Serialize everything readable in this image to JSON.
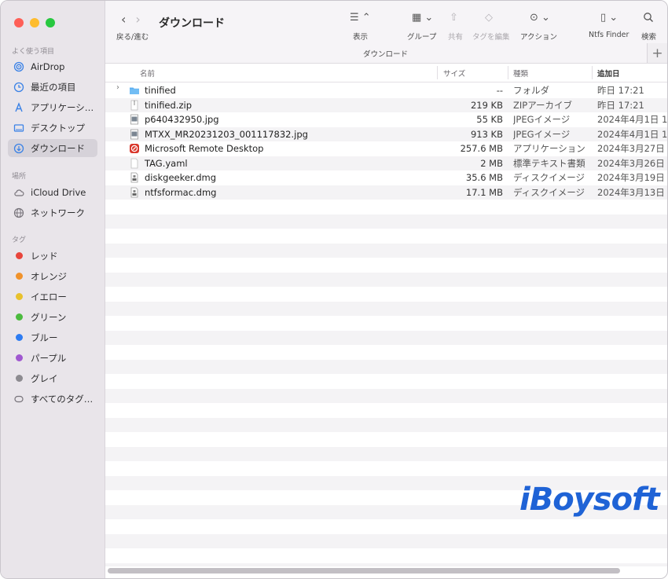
{
  "window": {
    "title": "ダウンロード"
  },
  "toolbar": {
    "back_forward_label": "戻る/進む",
    "view_label": "表示",
    "group_label": "グループ",
    "share_label": "共有",
    "tags_label": "タグを編集",
    "action_label": "アクション",
    "ntfs_label": "Ntfs Finder",
    "search_label": "検索",
    "path_title": "ダウンロード",
    "plus_label": "+"
  },
  "sidebar": {
    "favorites_header": "よく使う項目",
    "favorites": [
      {
        "label": "AirDrop",
        "icon": "airdrop-icon"
      },
      {
        "label": "最近の項目",
        "icon": "clock-icon"
      },
      {
        "label": "アプリケーシ…",
        "icon": "applications-icon"
      },
      {
        "label": "デスクトップ",
        "icon": "desktop-icon"
      },
      {
        "label": "ダウンロード",
        "icon": "download-icon"
      }
    ],
    "locations_header": "場所",
    "locations": [
      {
        "label": "iCloud Drive",
        "icon": "cloud-icon"
      },
      {
        "label": "ネットワーク",
        "icon": "globe-icon"
      }
    ],
    "tags_header": "タグ",
    "tags": [
      {
        "label": "レッド",
        "color": "#e8453c"
      },
      {
        "label": "オレンジ",
        "color": "#f0922b"
      },
      {
        "label": "イエロー",
        "color": "#e8c12d"
      },
      {
        "label": "グリーン",
        "color": "#4cbb3f"
      },
      {
        "label": "ブルー",
        "color": "#2e7cf2"
      },
      {
        "label": "パープル",
        "color": "#a058d0"
      },
      {
        "label": "グレイ",
        "color": "#8d8b90"
      }
    ],
    "all_tags": "すべてのタグ…"
  },
  "columns": {
    "name": "名前",
    "size": "サイズ",
    "kind": "種類",
    "date": "追加日"
  },
  "files": [
    {
      "name": "tinified",
      "size": "--",
      "kind": "フォルダ",
      "date": "昨日 17:21",
      "icon": "folder-icon"
    },
    {
      "name": "tinified.zip",
      "size": "219 KB",
      "kind": "ZIPアーカイブ",
      "date": "昨日 17:21",
      "icon": "zip-icon"
    },
    {
      "name": "p640432950.jpg",
      "size": "55 KB",
      "kind": "JPEGイメージ",
      "date": "2024年4月1日 1",
      "icon": "image-file-icon"
    },
    {
      "name": "MTXX_MR20231203_001117832.jpg",
      "size": "913 KB",
      "kind": "JPEGイメージ",
      "date": "2024年4月1日 1",
      "icon": "image-file-icon"
    },
    {
      "name": "Microsoft Remote Desktop",
      "size": "257.6 MB",
      "kind": "アプリケーション",
      "date": "2024年3月27日",
      "icon": "app-icon"
    },
    {
      "name": "TAG.yaml",
      "size": "2 MB",
      "kind": "標準テキスト書類",
      "date": "2024年3月26日",
      "icon": "text-file-icon"
    },
    {
      "name": "diskgeeker.dmg",
      "size": "35.6 MB",
      "kind": "ディスクイメージ",
      "date": "2024年3月19日",
      "icon": "disk-image-icon"
    },
    {
      "name": "ntfsformac.dmg",
      "size": "17.1 MB",
      "kind": "ディスクイメージ",
      "date": "2024年3月13日",
      "icon": "disk-image-icon"
    }
  ],
  "watermark": "iBoysoft"
}
